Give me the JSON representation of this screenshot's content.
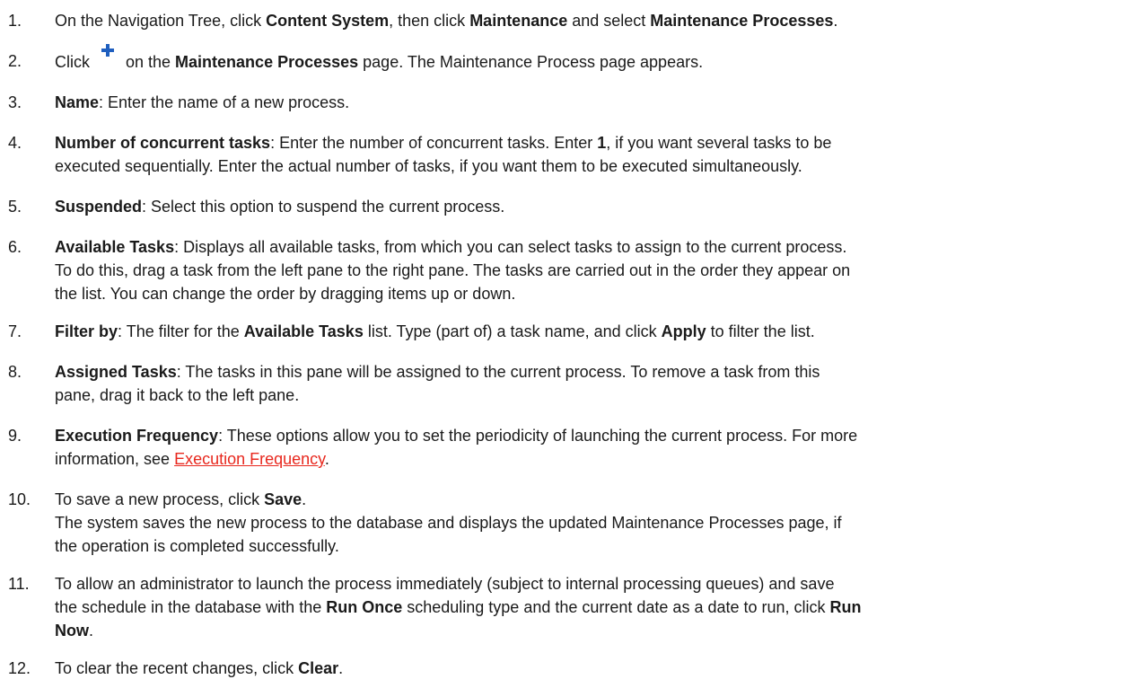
{
  "steps": [
    {
      "num": "1.",
      "lines": [
        [
          {
            "t": "On the Navigation Tree, click "
          },
          {
            "t": "Content System",
            "b": true
          },
          {
            "t": ", then click "
          },
          {
            "t": "Maintenance",
            "b": true
          },
          {
            "t": " and select "
          },
          {
            "t": "Maintenance Processes",
            "b": true
          },
          {
            "t": "."
          }
        ]
      ]
    },
    {
      "num": "2.",
      "lines": [
        [
          {
            "t": "Click "
          },
          {
            "icon": "plus-add-icon"
          },
          {
            "t": " on the "
          },
          {
            "t": "Maintenance Processes",
            "b": true
          },
          {
            "t": " page. The Maintenance Process page appears."
          }
        ]
      ]
    },
    {
      "num": "3.",
      "lines": [
        [
          {
            "t": "Name",
            "b": true
          },
          {
            "t": ": Enter the name of a new process."
          }
        ]
      ]
    },
    {
      "num": "4.",
      "lines": [
        [
          {
            "t": "Number of concurrent tasks",
            "b": true
          },
          {
            "t": ": Enter the number of concurrent tasks. Enter "
          },
          {
            "t": "1",
            "b": true
          },
          {
            "t": ", if you want several tasks to be"
          }
        ],
        [
          {
            "t": "executed sequentially. Enter the actual number of tasks, if you want them to be executed simultaneously."
          }
        ]
      ]
    },
    {
      "num": "5.",
      "lines": [
        [
          {
            "t": "Suspended",
            "b": true
          },
          {
            "t": ": Select this option to suspend the current process."
          }
        ]
      ]
    },
    {
      "num": "6.",
      "lines": [
        [
          {
            "t": "Available Tasks",
            "b": true
          },
          {
            "t": ": Displays all available tasks, from which you can select tasks to assign to the current process."
          }
        ],
        [
          {
            "t": "To do this, drag a task from the left pane to the right pane. The tasks are carried out in the order they appear on"
          }
        ],
        [
          {
            "t": "the list. You can change the order by dragging items up or down."
          }
        ]
      ]
    },
    {
      "num": "7.",
      "lines": [
        [
          {
            "t": "Filter by",
            "b": true
          },
          {
            "t": ": The filter for the "
          },
          {
            "t": "Available Tasks",
            "b": true
          },
          {
            "t": " list. Type (part of) a task name, and click "
          },
          {
            "t": "Apply",
            "b": true
          },
          {
            "t": " to filter the list."
          }
        ]
      ]
    },
    {
      "num": "8.",
      "lines": [
        [
          {
            "t": "Assigned Tasks",
            "b": true
          },
          {
            "t": ": The tasks in this pane will be assigned to the current process. To remove a task from this"
          }
        ],
        [
          {
            "t": "pane, drag it back to the left pane."
          }
        ]
      ]
    },
    {
      "num": "9.",
      "lines": [
        [
          {
            "t": "Execution Frequency",
            "b": true
          },
          {
            "t": ": These options allow you to set the periodicity of launching the current process. For more"
          }
        ],
        [
          {
            "t": "information, see "
          },
          {
            "t": "Execution Frequency",
            "link": true
          },
          {
            "t": "."
          }
        ]
      ]
    },
    {
      "num": "10.",
      "lines": [
        [
          {
            "t": "To save a new process, click "
          },
          {
            "t": "Save",
            "b": true
          },
          {
            "t": "."
          }
        ],
        [
          {
            "t": "The system saves the new process to the database and displays the updated Maintenance Processes page, if"
          }
        ],
        [
          {
            "t": "the operation is completed successfully."
          }
        ]
      ]
    },
    {
      "num": "11.",
      "lines": [
        [
          {
            "t": "To allow an administrator to launch the process immediately (subject to internal processing queues) and save"
          }
        ],
        [
          {
            "t": "the schedule in the database with the "
          },
          {
            "t": "Run Once",
            "b": true
          },
          {
            "t": " scheduling type and the current date as a date to run, click "
          },
          {
            "t": "Run",
            "b": true
          }
        ],
        [
          {
            "t": "Now",
            "b": true
          },
          {
            "t": "."
          }
        ]
      ]
    },
    {
      "num": "12.",
      "lines": [
        [
          {
            "t": "To clear the recent changes, click "
          },
          {
            "t": "Clear",
            "b": true
          },
          {
            "t": "."
          }
        ]
      ]
    }
  ],
  "colors": {
    "text": "#1a1a1a",
    "link": "#e8281e",
    "icon_plus": "#1f5fbf"
  }
}
